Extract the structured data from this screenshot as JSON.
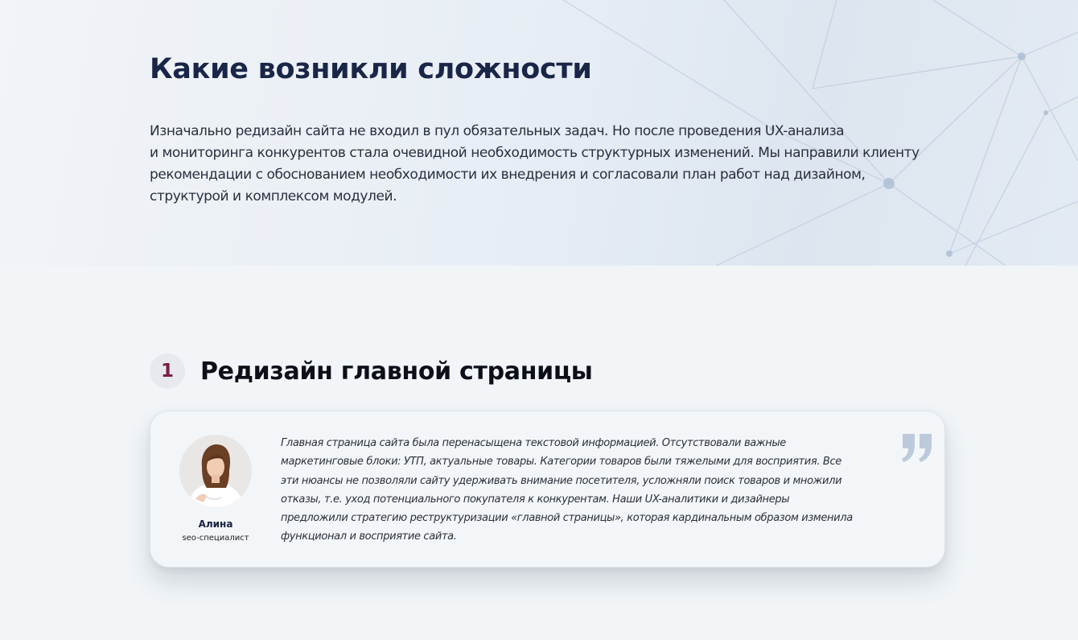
{
  "hero": {
    "title": "Какие возникли сложности",
    "text_lines": [
      "Изначально редизайн сайта не входил в пул обязательных задач. Но после проведения UX-анализа",
      "и мониторинга конкурентов стала очевидной необходимость структурных изменений. Мы направили клиенту",
      "рекомендации с обоснованием необходимости их внедрения и согласовали план работ над дизайном,",
      "структурой и комплексом модулей."
    ]
  },
  "section": {
    "number": "1",
    "title": "Редизайн главной страницы"
  },
  "quote": {
    "author_name": "Алина",
    "author_role": "seo-специалист",
    "lines": [
      "Главная страница сайта была перенасыщена текстовой информацией. Отсутствовали важные",
      "маркетинговые блоки: УТП, актуальные товары. Категории товаров были тяжелыми для восприятия. Все",
      "эти нюансы не позволяли сайту удерживать внимание посетителя, усложняли поиск товаров и множили",
      "отказы, т.е. уход потенциального покупателя к конкурентам. Наши UX-аналитики и дизайнеры",
      "предложили стратегию реструктуризации «главной страницы», которая кардинальным образом изменила",
      "функционал и восприятие сайта."
    ],
    "icon": "quote-icon"
  },
  "colors": {
    "page_bg": "#f1f5f8",
    "heading": "#1a2648",
    "step_number": "#7b1e46",
    "quote_mark": "#bccadb"
  }
}
